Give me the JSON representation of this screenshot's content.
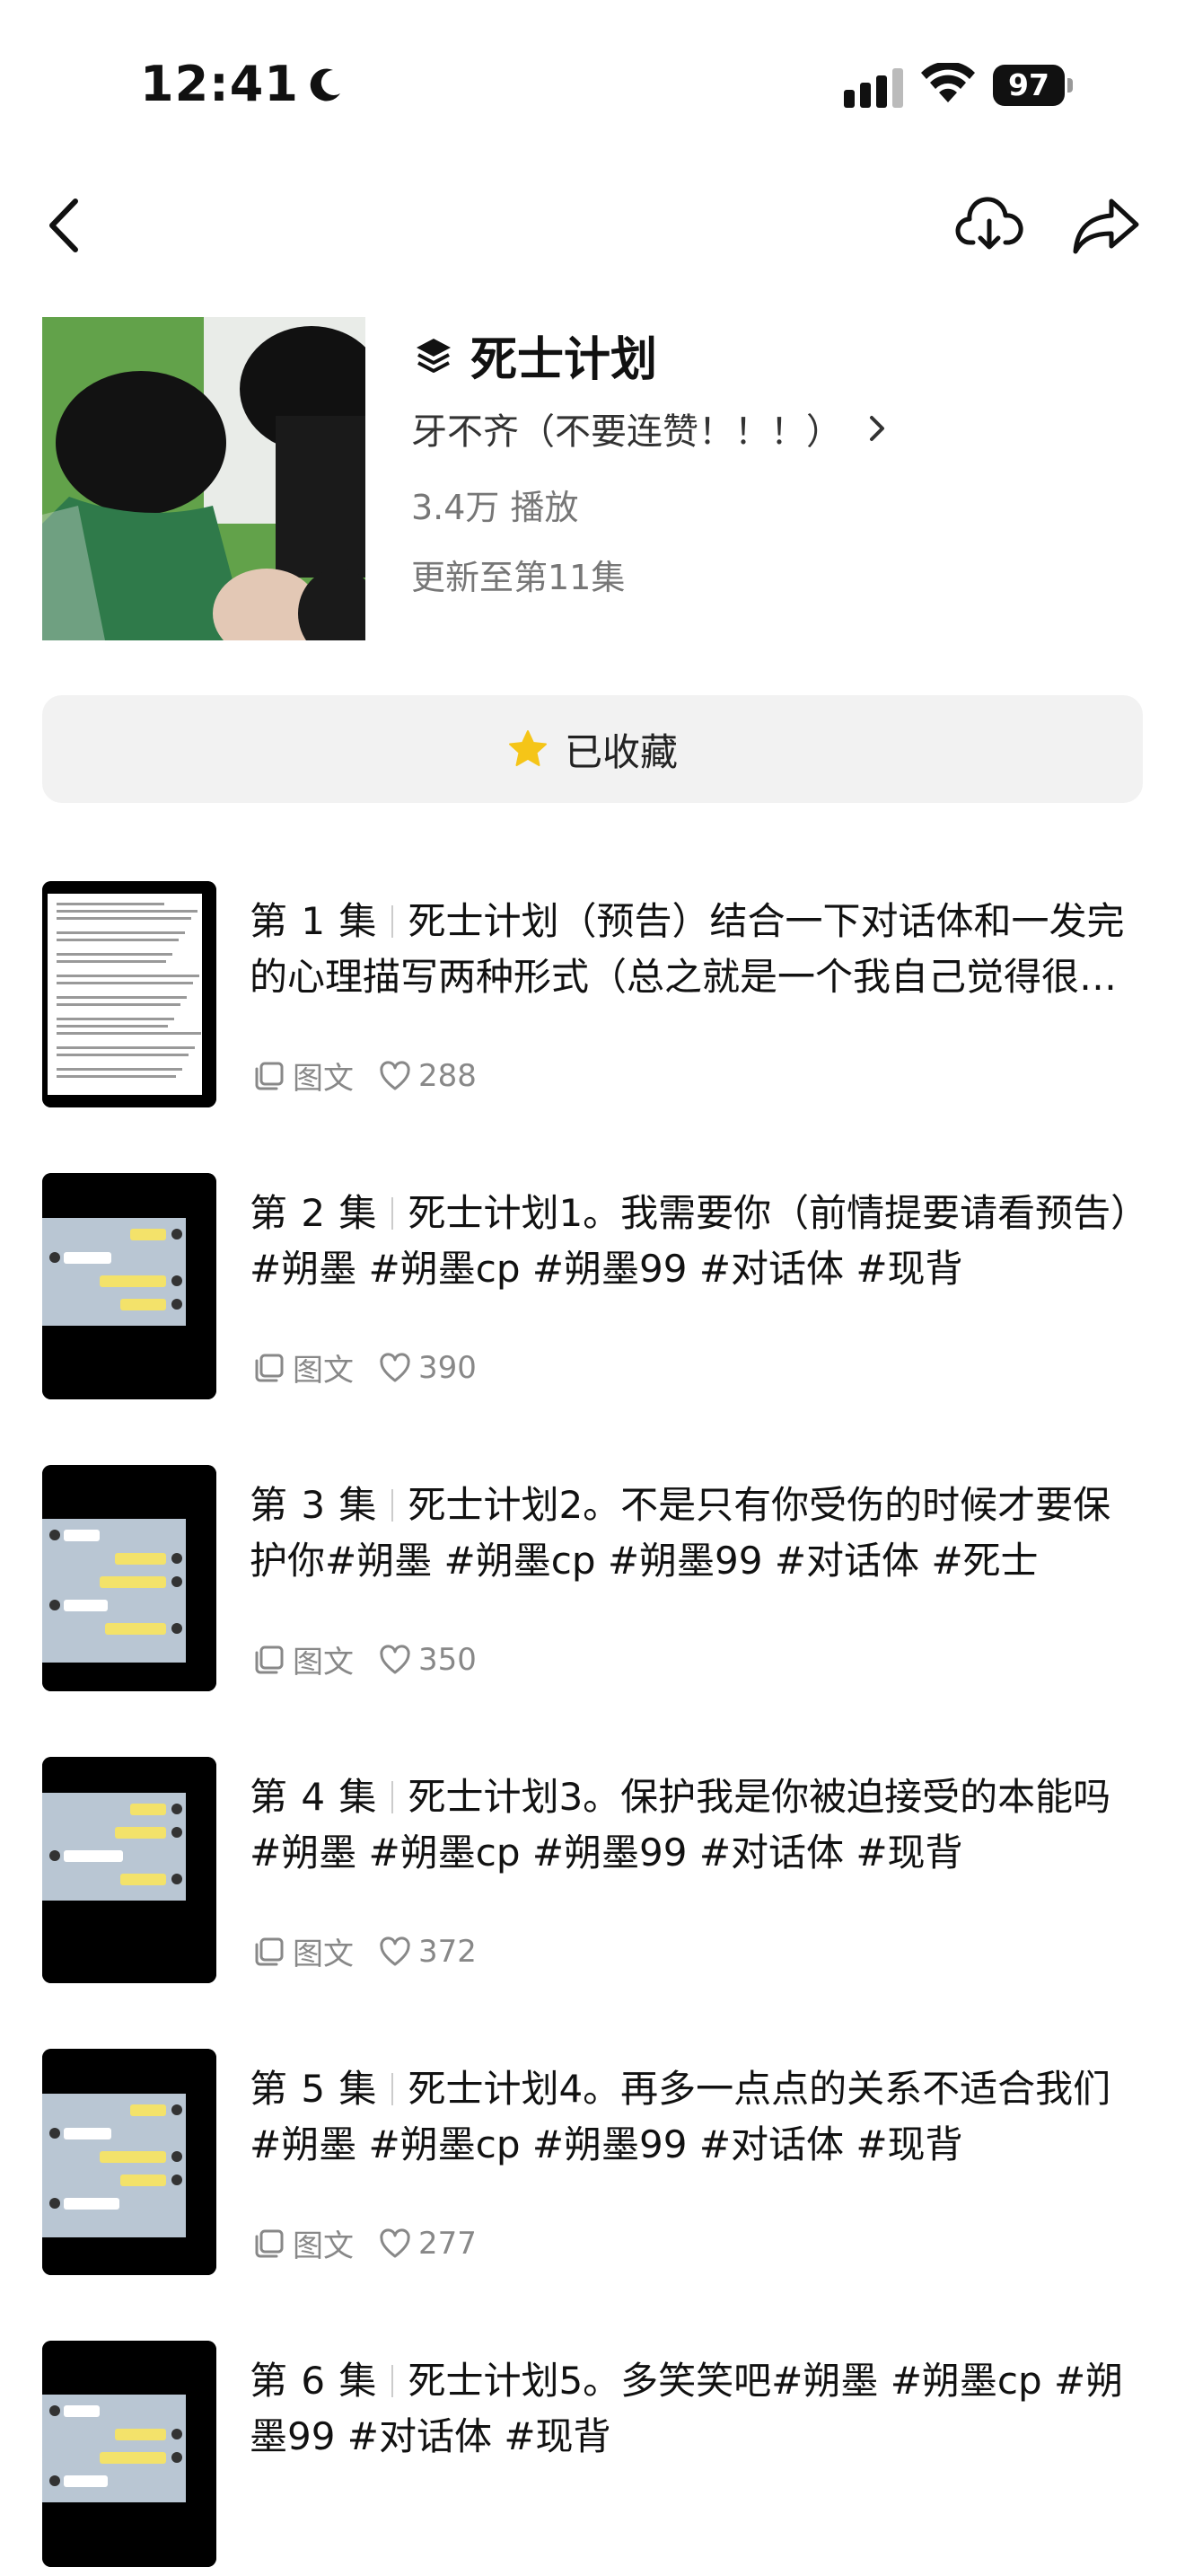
{
  "status_bar": {
    "time": "12:41",
    "battery": "97"
  },
  "header": {
    "title": "死士计划",
    "author": "牙不齐（不要连赞！！！）",
    "plays": "3.4万 播放",
    "updated": "更新至第11集"
  },
  "favorite_button": {
    "label": "已收藏"
  },
  "icons": {
    "back": "chevron-left-icon",
    "download": "cloud-download-icon",
    "share": "share-arrow-icon",
    "collection": "stack-icon",
    "star": "star-icon",
    "image_text": "image-text-icon",
    "like": "heart-icon"
  },
  "colors": {
    "star": "#f5c518",
    "accent_text": "#111111",
    "muted": "#888888"
  },
  "episodes": [
    {
      "number": "第 1 集",
      "title": "死士计划（预告）结合一下对话体和一发完的心理描写两种形式（总之就是一个我自己觉得很好玩的尝试",
      "type": "图文",
      "likes": "288",
      "thumb": "text"
    },
    {
      "number": "第 2 集",
      "title": "死士计划1。我需要你（前情提要请看预告）#朔墨 #朔墨cp #朔墨99 #对话体 #现背",
      "type": "图文",
      "likes": "390",
      "thumb": "chat"
    },
    {
      "number": "第 3 集",
      "title": "死士计划2。不是只有你受伤的时候才要保护你#朔墨 #朔墨cp #朔墨99 #对话体 #死士",
      "type": "图文",
      "likes": "350",
      "thumb": "chat"
    },
    {
      "number": "第 4 集",
      "title": "死士计划3。保护我是你被迫接受的本能吗#朔墨 #朔墨cp #朔墨99 #对话体 #现背",
      "type": "图文",
      "likes": "372",
      "thumb": "chat"
    },
    {
      "number": "第 5 集",
      "title": "死士计划4。再多一点点的关系不适合我们#朔墨 #朔墨cp #朔墨99 #对话体 #现背",
      "type": "图文",
      "likes": "277",
      "thumb": "chat"
    },
    {
      "number": "第 6 集",
      "title": "死士计划5。多笑笑吧#朔墨 #朔墨cp #朔墨99 #对话体 #现背",
      "type": "",
      "likes": "",
      "thumb": "chat"
    }
  ]
}
